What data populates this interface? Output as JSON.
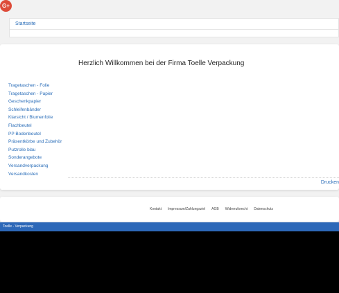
{
  "social": {
    "gplus_label": "G+"
  },
  "breadcrumb": {
    "home": "Startseite"
  },
  "main": {
    "welcome": "Herzlich Willkommen bei der Firma Toelle Verpackung",
    "print_label": "Drucken"
  },
  "sidebar": {
    "items": [
      {
        "label": "Tragetaschen - Folie"
      },
      {
        "label": "Tragetaschen - Papier"
      },
      {
        "label": "Geschenkpapier"
      },
      {
        "label": "Schleifenbänder"
      },
      {
        "label": "Klarsicht / Blumenfolie"
      },
      {
        "label": "Flachbeutel"
      },
      {
        "label": "PP Bodenbeutel"
      },
      {
        "label": "Präsentkörbe und Zubehör"
      },
      {
        "label": "Putzrolle blau"
      },
      {
        "label": "Sonderangebote"
      },
      {
        "label": "Versandverpackung"
      },
      {
        "label": "Versandkosten"
      }
    ]
  },
  "footer": {
    "links": [
      {
        "label": "Kontakt"
      },
      {
        "label": "Impressum/Zahlungsziel"
      },
      {
        "label": "AGB"
      },
      {
        "label": "Widerrufsrecht"
      },
      {
        "label": "Datenschutz"
      }
    ],
    "copyright": "Toelle - Verpackung"
  },
  "colors": {
    "link": "#2a6db8",
    "bar": "#2d68b8",
    "gplus": "#dd4b39"
  }
}
